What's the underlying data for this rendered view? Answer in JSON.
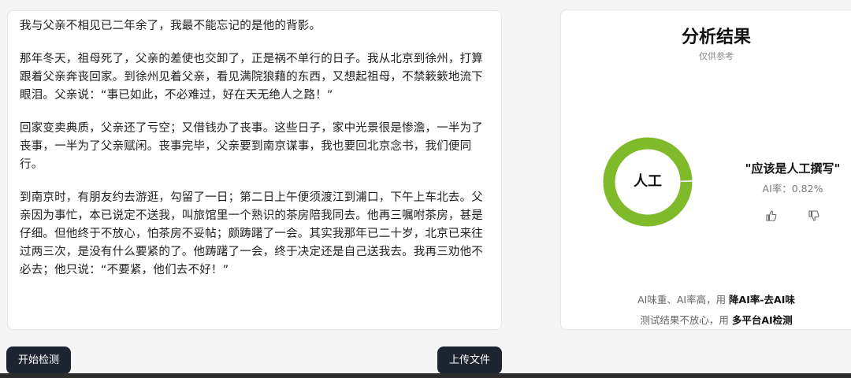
{
  "source_text": {
    "paragraphs": [
      "我与父亲不相见已二年余了，我最不能忘记的是他的背影。",
      "那年冬天，祖母死了，父亲的差使也交卸了，正是祸不单行的日子。我从北京到徐州，打算跟着父亲奔丧回家。到徐州见着父亲，看见满院狼藉的东西，又想起祖母，不禁簌簌地流下眼泪。父亲说：“事已如此，不必难过，好在天无绝人之路！”",
      "回家变卖典质，父亲还了亏空；又借钱办了丧事。这些日子，家中光景很是惨澹，一半为了丧事，一半为了父亲赋闲。丧事完毕，父亲要到南京谋事，我也要回北京念书，我们便同行。",
      "到南京时，有朋友约去游逛，勾留了一日；第二日上午便须渡江到浦口，下午上车北去。父亲因为事忙，本已说定不送我，叫旅馆里一个熟识的茶房陪我同去。他再三嘱咐茶房，甚是仔细。但他终于不放心，怕茶房不妥帖；颇踌躇了一会。其实我那年已二十岁，北京已来往过两三次，是没有什么要紧的了。他踌躇了一会，终于决定还是自己送我去。我再三劝他不必去；他只说：“不要紧，他们去不好！”"
    ]
  },
  "result": {
    "title": "分析结果",
    "subtitle": "仅供参考",
    "donut_label": "人工",
    "human_ratio": 0.9918,
    "verdict": "\"应该是人工撰写\"",
    "ai_rate": "AI率：0.82%",
    "tip1_prefix": "AI味重、AI率高，用 ",
    "tip1_link": "降AI率-去AI味",
    "tip2_prefix": "测试结果不放心，用 ",
    "tip2_link": "多平台AI检测",
    "colors": {
      "ring": "#7fba2a",
      "ring_track": "#e8e8e8"
    },
    "icons": {
      "like": "thumbs-up-icon",
      "dislike": "thumbs-down-icon"
    }
  },
  "buttons": {
    "start": "开始检测",
    "upload": "上传文件"
  }
}
